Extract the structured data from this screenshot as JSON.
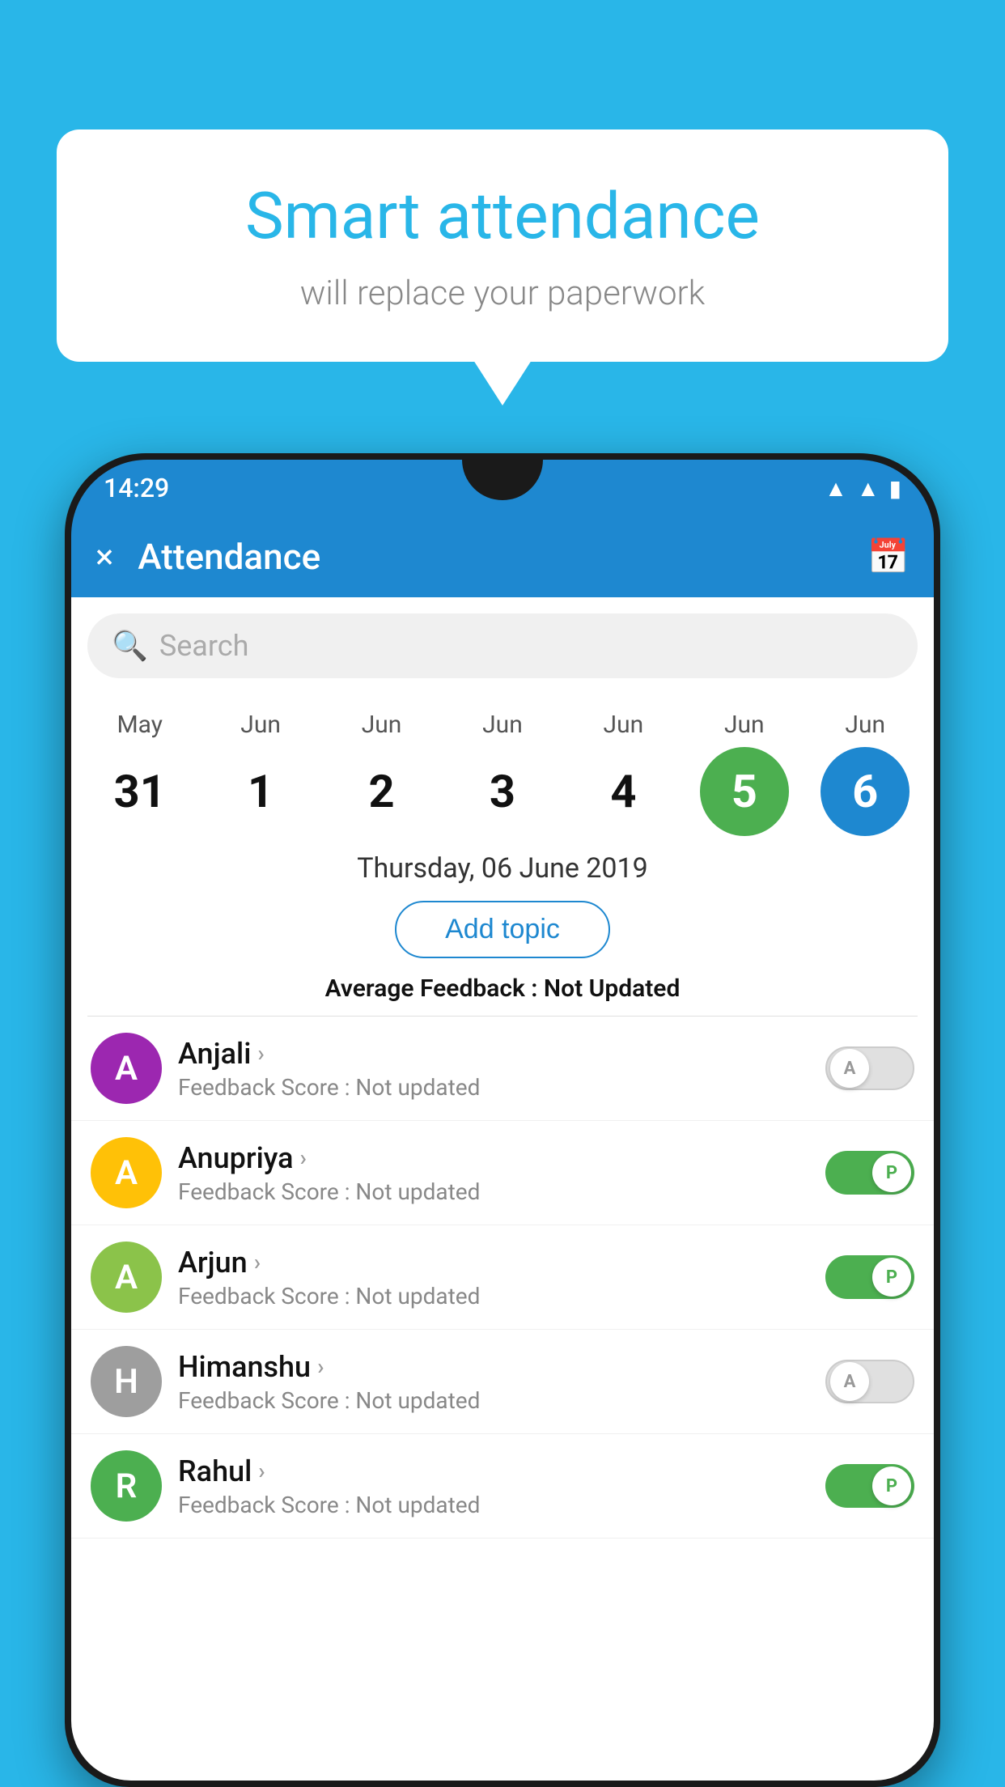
{
  "background_color": "#29b6e8",
  "bubble": {
    "title": "Smart attendance",
    "subtitle": "will replace your paperwork"
  },
  "status_bar": {
    "time": "14:29",
    "wifi_icon": "wifi",
    "signal_icon": "signal",
    "battery_icon": "battery"
  },
  "app_bar": {
    "title": "Attendance",
    "close_label": "×",
    "calendar_label": "📅"
  },
  "search": {
    "placeholder": "Search"
  },
  "calendar": {
    "days": [
      {
        "month": "May",
        "day": "31",
        "style": "normal"
      },
      {
        "month": "Jun",
        "day": "1",
        "style": "normal"
      },
      {
        "month": "Jun",
        "day": "2",
        "style": "normal"
      },
      {
        "month": "Jun",
        "day": "3",
        "style": "normal"
      },
      {
        "month": "Jun",
        "day": "4",
        "style": "normal"
      },
      {
        "month": "Jun",
        "day": "5",
        "style": "today"
      },
      {
        "month": "Jun",
        "day": "6",
        "style": "selected"
      }
    ],
    "selected_date": "Thursday, 06 June 2019"
  },
  "add_topic_label": "Add topic",
  "avg_feedback": {
    "label": "Average Feedback : ",
    "value": "Not Updated"
  },
  "students": [
    {
      "name": "Anjali",
      "avatar_letter": "A",
      "avatar_color": "#9c27b0",
      "feedback": "Feedback Score : Not updated",
      "toggle_state": "off",
      "toggle_label": "A"
    },
    {
      "name": "Anupriya",
      "avatar_letter": "A",
      "avatar_color": "#ffc107",
      "feedback": "Feedback Score : Not updated",
      "toggle_state": "on",
      "toggle_label": "P"
    },
    {
      "name": "Arjun",
      "avatar_letter": "A",
      "avatar_color": "#8bc34a",
      "feedback": "Feedback Score : Not updated",
      "toggle_state": "on",
      "toggle_label": "P"
    },
    {
      "name": "Himanshu",
      "avatar_letter": "H",
      "avatar_color": "#9e9e9e",
      "feedback": "Feedback Score : Not updated",
      "toggle_state": "off",
      "toggle_label": "A"
    },
    {
      "name": "Rahul",
      "avatar_letter": "R",
      "avatar_color": "#4caf50",
      "feedback": "Feedback Score : Not updated",
      "toggle_state": "on",
      "toggle_label": "P"
    }
  ]
}
